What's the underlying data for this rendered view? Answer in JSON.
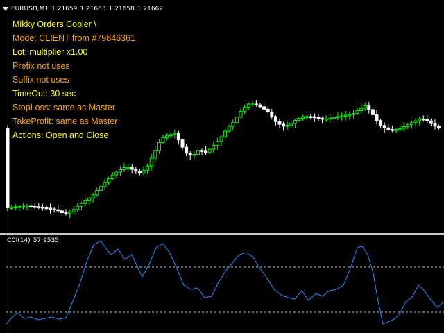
{
  "window": {
    "symbol": "EURUSD,M1",
    "quotes": [
      "1.21659",
      "1.21663",
      "1.21658",
      "1.21662"
    ]
  },
  "info": {
    "lines": [
      {
        "text": "Mikky Orders Copier \\",
        "color": "#ffff00"
      },
      {
        "text": "Mode: CLIENT from #79846361",
        "color": "#ffa500"
      },
      {
        "text": "Lot: multiplier x1.00",
        "color": "#ffff00"
      },
      {
        "text": "Prefix not uses",
        "color": "#ffa500"
      },
      {
        "text": "Suffix not uses",
        "color": "#ffa500"
      },
      {
        "text": "TimeOut: 30 sec",
        "color": "#ffff00"
      },
      {
        "text": "StopLoss: same as Master",
        "color": "#ffa500"
      },
      {
        "text": "TakeProfit: same as Master",
        "color": "#ffa500"
      },
      {
        "text": "Actions: Open and Close",
        "color": "#ffff00"
      }
    ]
  },
  "indicator": {
    "name": "CCI(14)",
    "value": "57.9535"
  },
  "colors": {
    "background": "#000000",
    "bull_candle": "#00ff00",
    "bear_candle": "#ffffff",
    "cci_line": "#1e90ff",
    "level_line": "#c0c0c0"
  }
}
